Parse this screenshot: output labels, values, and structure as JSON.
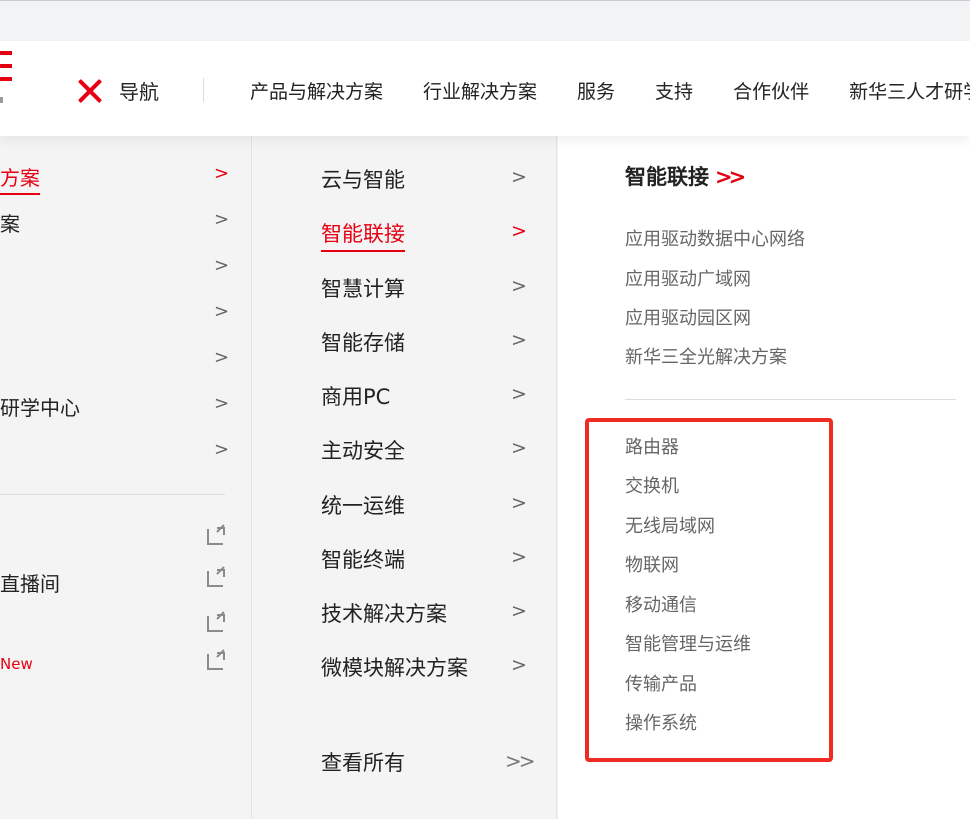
{
  "header": {
    "nav_title": "导航",
    "topnav": [
      "产品与解决方案",
      "行业解决方案",
      "服务",
      "支持",
      "合作伙伴",
      "新华三人才研学"
    ]
  },
  "col1": {
    "items": [
      {
        "label": "方案",
        "active": true
      },
      {
        "label": "案"
      },
      {
        "label": ""
      },
      {
        "label": ""
      },
      {
        "label": ""
      },
      {
        "label": "研学中心"
      },
      {
        "label": ""
      }
    ],
    "external": [
      {
        "label": ""
      },
      {
        "label": "直播间"
      },
      {
        "label": ""
      },
      {
        "label": "New"
      }
    ]
  },
  "col2": {
    "items": [
      "云与智能",
      "智能联接",
      "智慧计算",
      "智能存储",
      "商用PC",
      "主动安全",
      "统一运维",
      "智能终端",
      "技术解决方案",
      "微模块解决方案"
    ],
    "active_index": 1,
    "view_all": "查看所有"
  },
  "col3": {
    "title": "智能联接",
    "group1": [
      "应用驱动数据中心网络",
      "应用驱动广域网",
      "应用驱动园区网",
      "新华三全光解决方案"
    ],
    "group2": [
      "路由器",
      "交换机",
      "无线局域网",
      "物联网",
      "移动通信",
      "智能管理与运维",
      "传输产品",
      "操作系统"
    ]
  },
  "colors": {
    "accent": "#e60012",
    "highlight_box": "#ee2c22"
  },
  "icons": {
    "close": "close-icon",
    "chevron": "chevron-right-icon",
    "double_chevron": "double-chevron-right-icon",
    "external_link": "external-link-icon"
  }
}
